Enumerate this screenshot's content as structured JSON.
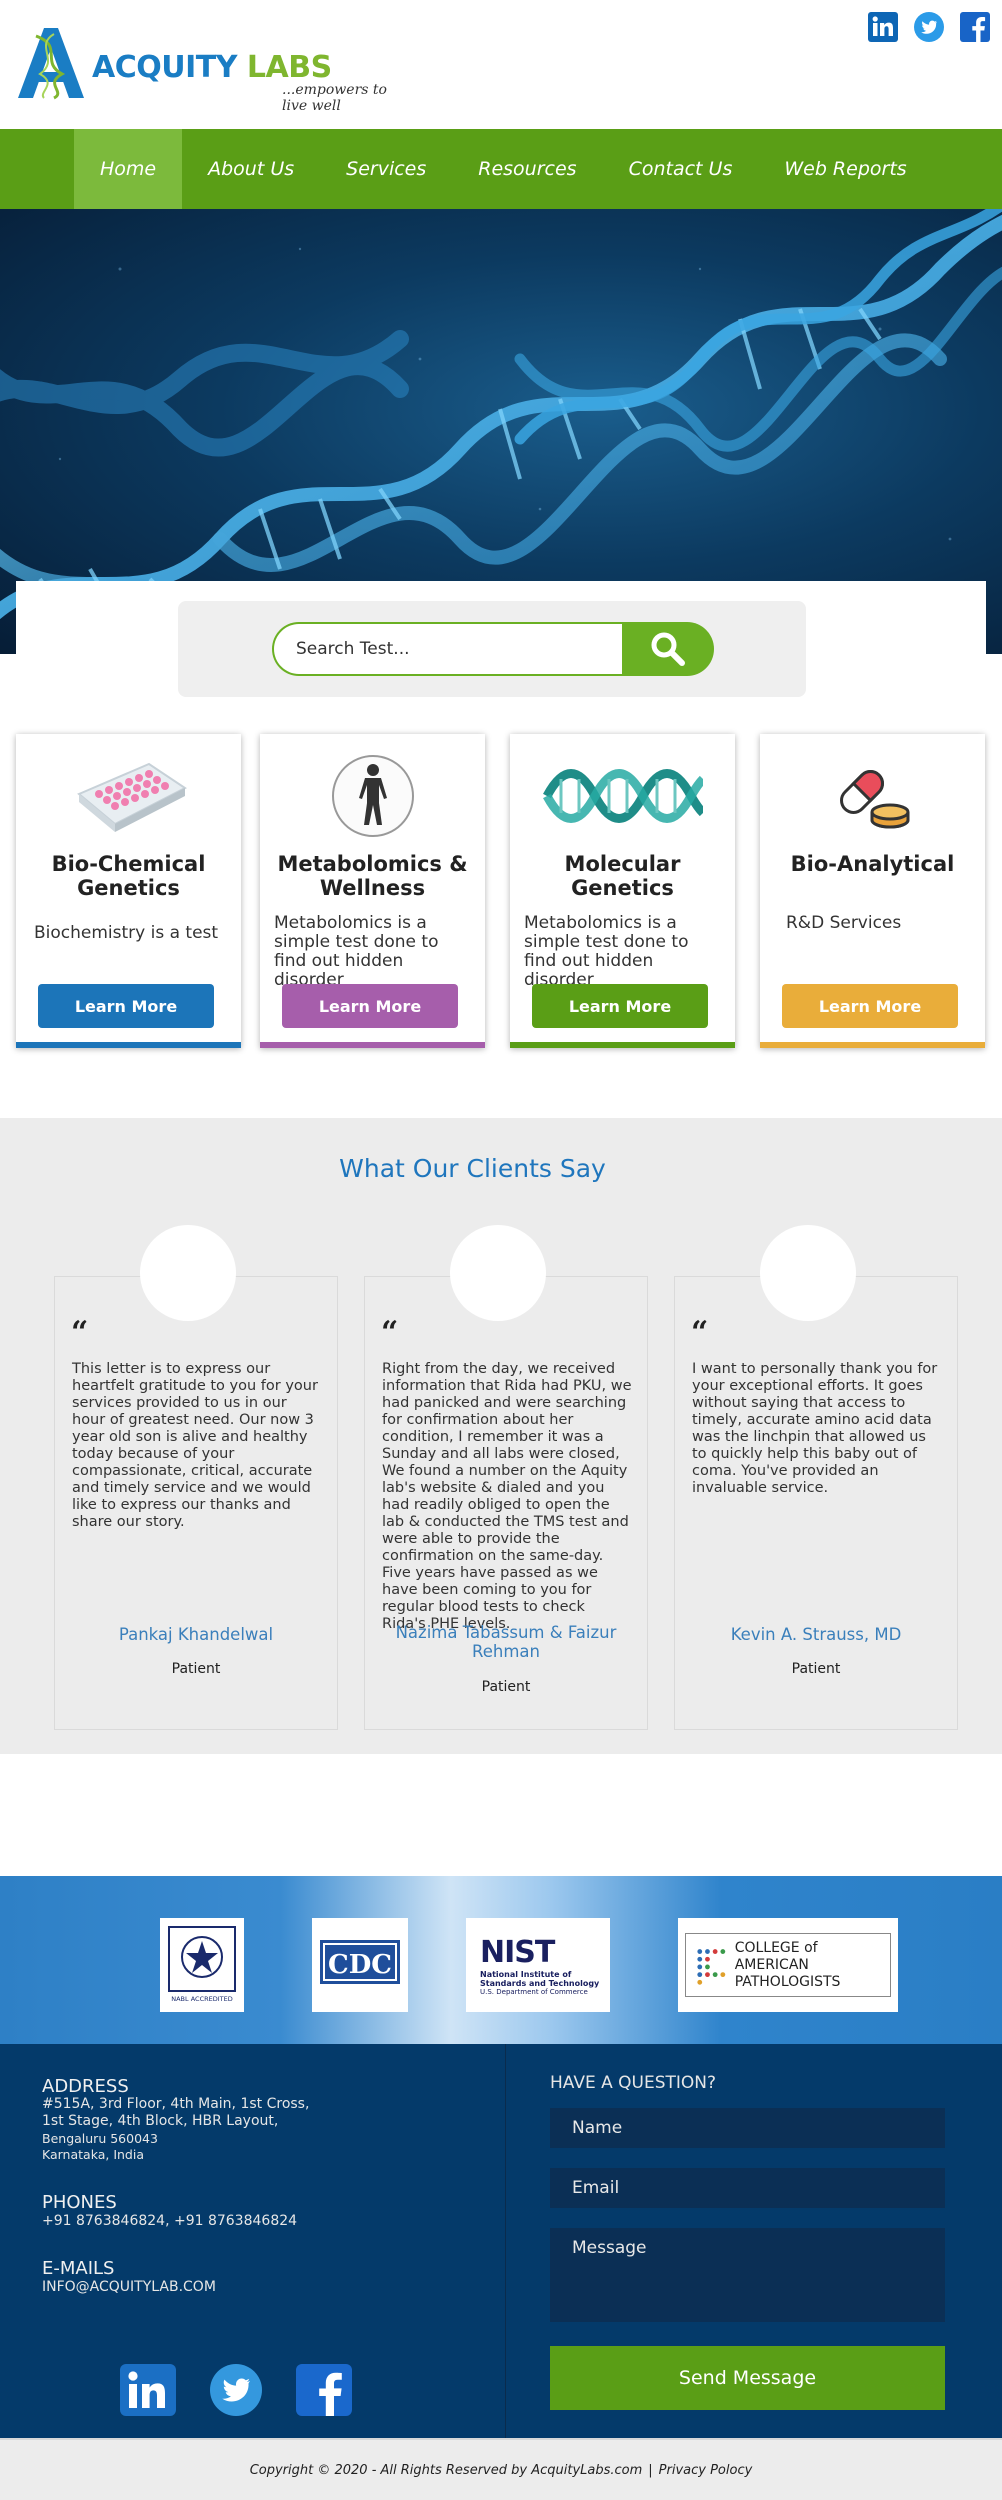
{
  "brand": {
    "name_part1": "ACQUITY",
    "name_part2": " LABS",
    "tagline": "...empowers to live well",
    "primary": "#1a7dc4",
    "secondary": "#7fb62f"
  },
  "social": [
    "linkedin-icon",
    "twitter-icon",
    "facebook-icon"
  ],
  "nav": {
    "items": [
      {
        "label": "Home"
      },
      {
        "label": "About Us"
      },
      {
        "label": "Services"
      },
      {
        "label": "Resources"
      },
      {
        "label": "Contact Us"
      },
      {
        "label": "Web Reports"
      }
    ],
    "active": "Home",
    "color": "#5a9e16"
  },
  "search": {
    "placeholder": "Search Test..."
  },
  "services": [
    {
      "title": "Bio-Chemical Genetics",
      "desc": "Biochemistry is a test",
      "button": "Learn More",
      "color": "#1c75b9"
    },
    {
      "title": "Metabolomics & Wellness",
      "desc": "Metabolomics is a simple test done to find out hidden disorder",
      "button": "Learn More",
      "color": "#a65eab"
    },
    {
      "title": "Molecular Genetics",
      "desc": "Metabolomics is a simple test done to find out hidden disorder",
      "button": "Learn More",
      "color": "#5a9e16"
    },
    {
      "title": "Bio-Analytical",
      "desc": "R&D Services",
      "button": "Learn More",
      "color": "#e9ad3a"
    }
  ],
  "testimonials": {
    "title": "What Our Clients Say",
    "items": [
      {
        "text": "This letter is to express our heartfelt gratitude to you for your services provided to us in our hour of greatest need. Our now 3 year old son is alive and healthy today because of your compassionate, critical, accurate and timely service and we would like to express our thanks and share our story.",
        "name": "Pankaj Khandelwal",
        "role": "Patient"
      },
      {
        "text": "Right from the day, we received information that Rida had PKU, we had panicked and were searching for confirmation about her condition, I remember it was a Sunday and all labs were closed, We found a number on the Aquity lab's website & dialed and you had readily obliged to open the lab & conducted the TMS test and were able to provide the confirmation on the same-day. Five years have passed as we have been coming to you for regular blood tests to check Rida's PHE levels.",
        "name": "Nazima Tabassum & Faizur Rehman",
        "role": "Patient"
      },
      {
        "text": "I want to personally thank you for your exceptional efforts. It goes without saying that access to timely, accurate amino acid data was the linchpin that allowed us to quickly help this baby out of coma. You've provided an invaluable service.",
        "name": "Kevin A. Strauss, MD",
        "role": "Patient"
      }
    ]
  },
  "accreditations": {
    "nabl": "NABL ACCREDITED",
    "cdc": "CDC",
    "nist_main": "NIST",
    "nist_sub1": "National Institute of",
    "nist_sub2": "Standards and Technology",
    "nist_sub3": "U.S. Department of Commerce",
    "cap1": "COLLEGE of AMERICAN",
    "cap2": "PATHOLOGISTS"
  },
  "footer": {
    "address_label": "ADDRESS",
    "address_line1": "#515A, 3rd Floor, 4th Main, 1st Cross,",
    "address_line2": "1st Stage, 4th Block, HBR Layout,",
    "address_line3": "Bengaluru 560043",
    "address_line4": "Karnataka, India",
    "phones_label": "PHONES",
    "phones": "+91 8763846824, +91 8763846824",
    "emails_label": "E-MAILS",
    "email": "INFO@ACQUITYLAB.COM",
    "question_label": "HAVE A QUESTION?",
    "name_placeholder": "Name",
    "email_placeholder": "Email",
    "message_placeholder": "Message",
    "send_label": "Send Message"
  },
  "copyright": {
    "text": "Copyright © 2020 - All Rights Reserved by AcquityLabs.com",
    "sep": "|",
    "privacy": "Privacy Polocy"
  }
}
